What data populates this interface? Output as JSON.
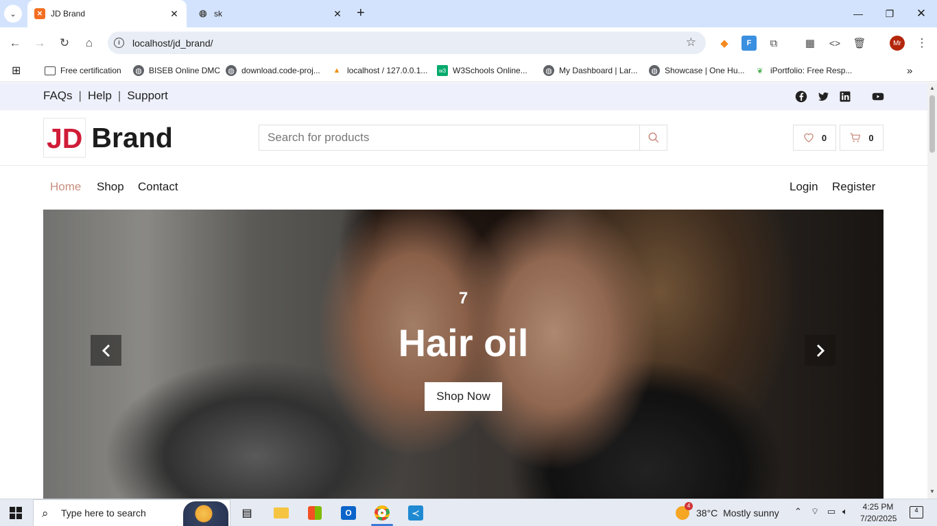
{
  "browser": {
    "tabs": [
      {
        "title": "JD Brand",
        "active": true
      },
      {
        "title": "sk",
        "active": false
      }
    ],
    "url": "localhost/jd_brand/",
    "bookmarks": [
      {
        "label": "Free certification",
        "icon": "folder-icon"
      },
      {
        "label": "BISEB Online DMC",
        "icon": "globe-icon"
      },
      {
        "label": "download.code-proj...",
        "icon": "globe-icon"
      },
      {
        "label": "localhost / 127.0.0.1...",
        "icon": "phpmyadmin-icon"
      },
      {
        "label": "W3Schools Online...",
        "icon": "w3schools-icon"
      },
      {
        "label": "My Dashboard | Lar...",
        "icon": "globe-icon"
      },
      {
        "label": "Showcase | One Hu...",
        "icon": "globe-icon"
      },
      {
        "label": "iPortfolio: Free Resp...",
        "icon": "leaf-icon"
      }
    ],
    "profile_initials": "Mr"
  },
  "site": {
    "top_links": [
      "FAQs",
      "Help",
      "Support"
    ],
    "logo": {
      "part1": "JD",
      "part2": "Brand"
    },
    "search_placeholder": "Search for products",
    "wishlist_count": "0",
    "cart_count": "0",
    "nav": {
      "left": [
        "Home",
        "Shop",
        "Contact"
      ],
      "right": [
        "Login",
        "Register"
      ],
      "active": "Home"
    },
    "hero": {
      "number": "7",
      "title": "Hair oil",
      "button": "Shop Now"
    },
    "colors": {
      "brand_red": "#d01c37",
      "nav_active": "#c98e7f",
      "topbar_bg": "#eef0fb"
    }
  },
  "taskbar": {
    "search_placeholder": "Type here to search",
    "weather": {
      "temp": "38°C",
      "condition": "Mostly sunny",
      "badge": "4"
    },
    "time": "4:25 PM",
    "date": "7/20/2025",
    "notifications": "4"
  }
}
